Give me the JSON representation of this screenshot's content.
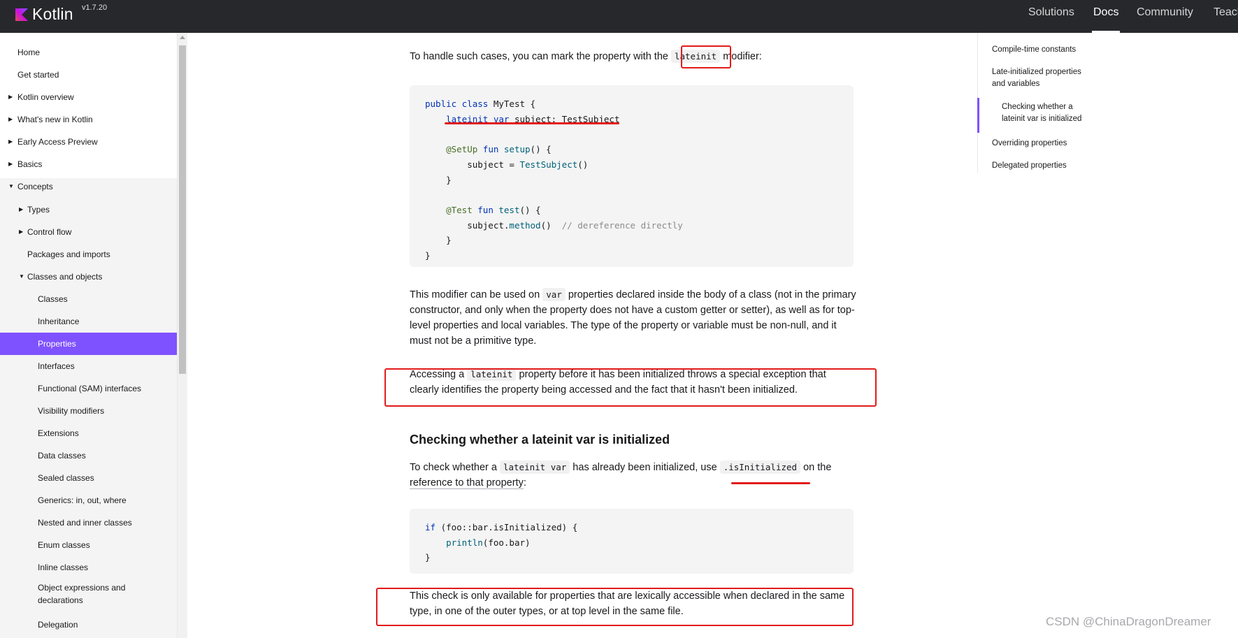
{
  "header": {
    "logo_text": "Kotlin",
    "version": "v1.7.20",
    "nav": [
      "Solutions",
      "Docs",
      "Community",
      "Teach"
    ],
    "active_nav": "Docs"
  },
  "sidebar": {
    "items": [
      {
        "label": "Home",
        "indent": 0,
        "caret": "",
        "active": false
      },
      {
        "label": "Get started",
        "indent": 0,
        "caret": "",
        "active": false
      },
      {
        "label": "Kotlin overview",
        "indent": 0,
        "caret": "▶",
        "active": false
      },
      {
        "label": "What's new in Kotlin",
        "indent": 0,
        "caret": "▶",
        "active": false
      },
      {
        "label": "Early Access Preview",
        "indent": 0,
        "caret": "▶",
        "active": false
      },
      {
        "label": "Basics",
        "indent": 0,
        "caret": "▶",
        "active": false
      },
      {
        "label": "Concepts",
        "indent": 0,
        "caret": "▼",
        "active": false
      },
      {
        "label": "Types",
        "indent": 1,
        "caret": "▶",
        "active": false
      },
      {
        "label": "Control flow",
        "indent": 1,
        "caret": "▶",
        "active": false
      },
      {
        "label": "Packages and imports",
        "indent": 1,
        "caret": "",
        "active": false
      },
      {
        "label": "Classes and objects",
        "indent": 1,
        "caret": "▼",
        "active": false
      },
      {
        "label": "Classes",
        "indent": 2,
        "caret": "",
        "active": false
      },
      {
        "label": "Inheritance",
        "indent": 2,
        "caret": "",
        "active": false
      },
      {
        "label": "Properties",
        "indent": 2,
        "caret": "",
        "active": true
      },
      {
        "label": "Interfaces",
        "indent": 2,
        "caret": "",
        "active": false
      },
      {
        "label": "Functional (SAM) interfaces",
        "indent": 2,
        "caret": "",
        "active": false
      },
      {
        "label": "Visibility modifiers",
        "indent": 2,
        "caret": "",
        "active": false
      },
      {
        "label": "Extensions",
        "indent": 2,
        "caret": "",
        "active": false
      },
      {
        "label": "Data classes",
        "indent": 2,
        "caret": "",
        "active": false
      },
      {
        "label": "Sealed classes",
        "indent": 2,
        "caret": "",
        "active": false
      },
      {
        "label": "Generics: in, out, where",
        "indent": 2,
        "caret": "",
        "active": false
      },
      {
        "label": "Nested and inner classes",
        "indent": 2,
        "caret": "",
        "active": false
      },
      {
        "label": "Enum classes",
        "indent": 2,
        "caret": "",
        "active": false
      },
      {
        "label": "Inline classes",
        "indent": 2,
        "caret": "",
        "active": false
      },
      {
        "label": "Object expressions and declarations",
        "indent": 2,
        "caret": "",
        "active": false
      },
      {
        "label": "Delegation",
        "indent": 2,
        "caret": "",
        "active": false
      }
    ]
  },
  "toc": {
    "items": [
      {
        "label": "Compile-time constants",
        "sub": false
      },
      {
        "label": "Late-initialized properties and variables",
        "sub": false
      },
      {
        "label": "Checking whether a lateinit var is initialized",
        "sub": true
      },
      {
        "label": "Overriding properties",
        "sub": false
      },
      {
        "label": "Delegated properties",
        "sub": false
      }
    ]
  },
  "main": {
    "p1": {
      "before": "To handle such cases, you can mark the property with the ",
      "code": "lateinit",
      "after": " modifier:"
    },
    "code1": [
      [
        [
          "kw",
          "public class "
        ],
        [
          "",
          "MyTest {"
        ]
      ],
      [
        [
          "",
          "    "
        ],
        [
          "kw",
          "lateinit var "
        ],
        [
          "",
          "subject: TestSubject"
        ]
      ],
      [
        [
          "",
          ""
        ]
      ],
      [
        [
          "",
          "    "
        ],
        [
          "ann",
          "@SetUp "
        ],
        [
          "kw",
          "fun "
        ],
        [
          "fn",
          "setup"
        ],
        [
          "",
          "() {"
        ]
      ],
      [
        [
          "",
          "        subject = "
        ],
        [
          "fn",
          "TestSubject"
        ],
        [
          "",
          "()"
        ]
      ],
      [
        [
          "",
          "    }"
        ]
      ],
      [
        [
          "",
          ""
        ]
      ],
      [
        [
          "",
          "    "
        ],
        [
          "ann",
          "@Test "
        ],
        [
          "kw",
          "fun "
        ],
        [
          "fn",
          "test"
        ],
        [
          "",
          "() {"
        ]
      ],
      [
        [
          "",
          "        subject."
        ],
        [
          "fn",
          "method"
        ],
        [
          "",
          "()  "
        ],
        [
          "cm",
          "// dereference directly"
        ]
      ],
      [
        [
          "",
          "    }"
        ]
      ],
      [
        [
          "",
          "}"
        ]
      ]
    ],
    "p2": {
      "before": "This modifier can be used on ",
      "code": "var",
      "after": " properties declared inside the body of a class (not in the primary constructor, and only when the property does not have a custom getter or setter), as well as for top-level properties and local variables. The type of the property or variable must be non-null, and it must not be a primitive type."
    },
    "p3": {
      "before": "Accessing a ",
      "code": "lateinit",
      "after": " property before it has been initialized throws a special exception that clearly identifies the property being accessed and the fact that it hasn't been initialized."
    },
    "heading": "Checking whether a lateinit var is initialized",
    "p4": {
      "before": "To check whether a ",
      "code": "lateinit var",
      "middle": " has already been initialized, use ",
      "code2": ".isInitialized",
      "after": " on the ",
      "link": "reference to that property",
      "end": ":"
    },
    "code2": [
      [
        [
          "kw",
          "if "
        ],
        [
          "",
          "(foo::bar.isInitialized) {"
        ]
      ],
      [
        [
          "",
          "    "
        ],
        [
          "fn",
          "println"
        ],
        [
          "",
          "(foo.bar)"
        ]
      ],
      [
        [
          "",
          "}"
        ]
      ]
    ],
    "p5": "This check is only available for properties that are lexically accessible when declared in the same type, in one of the outer types, or at top level in the same file."
  },
  "watermark": "CSDN @ChinaDragonDreamer",
  "colors": {
    "accent": "#7f52ff",
    "annotation_red": "#e21b1b",
    "topbar": "#27282c"
  }
}
